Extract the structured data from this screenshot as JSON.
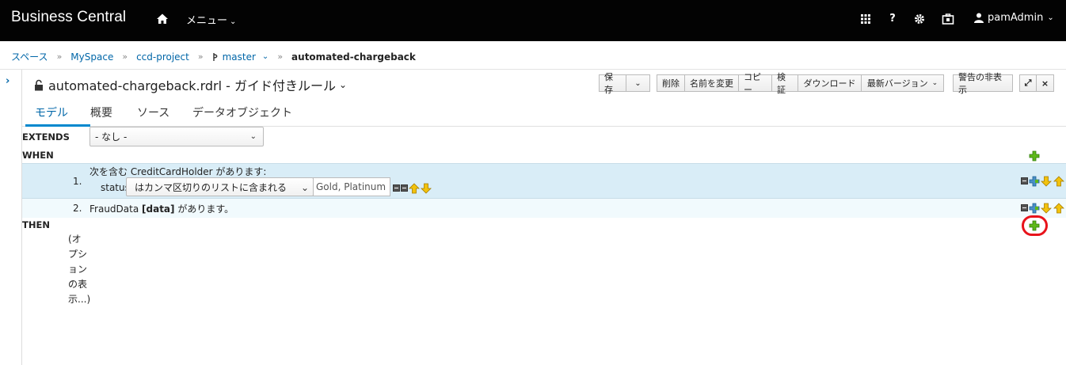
{
  "topbar": {
    "brand": "Business Central",
    "menu_label": "メニュー",
    "user_label": "pamAdmin"
  },
  "breadcrumb": {
    "items": [
      "スペース",
      "MySpace",
      "ccd-project"
    ],
    "branch": "master",
    "current": "automated-chargeback"
  },
  "editor": {
    "file_title": "automated-chargeback.rdrl - ガイド付きルール",
    "toolbar": {
      "save": "保存",
      "delete": "削除",
      "rename": "名前を変更",
      "copy": "コピー",
      "validate": "検証",
      "download": "ダウンロード",
      "latest_version": "最新バージョン",
      "hide_alerts": "警告の非表示"
    },
    "tabs": [
      "モデル",
      "概要",
      "ソース",
      "データオブジェクト"
    ],
    "active_tab": "モデル"
  },
  "rule": {
    "extends_label": "EXTENDS",
    "extends_value": "- なし -",
    "when_label": "WHEN",
    "then_label": "THEN",
    "conditions": [
      {
        "number": "1.",
        "text": "次を含む CreditCardHolder があります:",
        "field": "status",
        "operator": "はカンマ区切りのリストに含まれる",
        "value": "Gold, Platinum"
      },
      {
        "number": "2.",
        "text_before": "FraudData ",
        "binding": "[data]",
        "text_after": " があります。"
      }
    ],
    "show_options": "(オプションの表示...)"
  },
  "colors": {
    "accent": "#0088ce",
    "link": "#0066a8",
    "row_selected": "#d9edf7",
    "row_alt": "#f1fafd",
    "highlight": "#e8131b",
    "topbar": "#030303"
  }
}
